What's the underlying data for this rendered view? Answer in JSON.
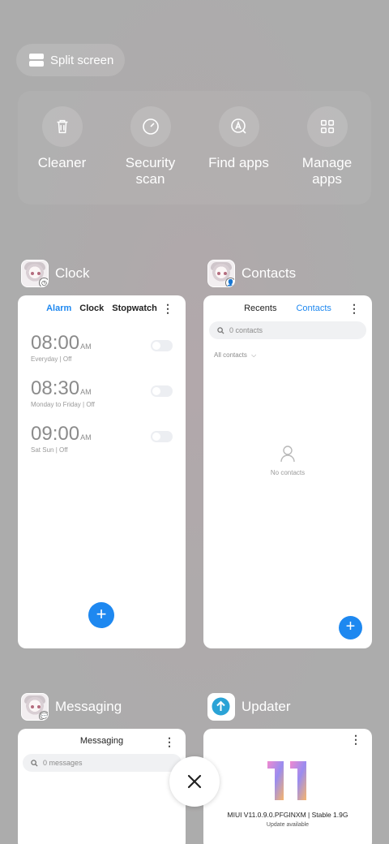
{
  "split_screen": {
    "label": "Split screen"
  },
  "tools": [
    {
      "label": "Cleaner",
      "icon": "trash-icon"
    },
    {
      "label": "Security scan",
      "icon": "speedometer-icon"
    },
    {
      "label": "Find apps",
      "icon": "app-search-icon"
    },
    {
      "label": "Manage apps",
      "icon": "grid-icon"
    }
  ],
  "apps": {
    "clock": {
      "name": "Clock",
      "tabs": [
        "Alarm",
        "Clock",
        "Stopwatch"
      ],
      "active_tab": "Alarm",
      "alarms": [
        {
          "time": "08:00",
          "ampm": "AM",
          "sub": "Everyday | Off"
        },
        {
          "time": "08:30",
          "ampm": "AM",
          "sub": "Monday to Friday | Off"
        },
        {
          "time": "09:00",
          "ampm": "AM",
          "sub": "Sat Sun | Off"
        }
      ],
      "fab": "+"
    },
    "contacts": {
      "name": "Contacts",
      "tabs": [
        "Recents",
        "Contacts"
      ],
      "active_tab": "Contacts",
      "search_placeholder": "0 contacts",
      "filter": "All contacts",
      "empty_text": "No contacts",
      "fab": "+"
    },
    "messaging": {
      "name": "Messaging",
      "title": "Messaging",
      "search_placeholder": "0 messages"
    },
    "updater": {
      "name": "Updater",
      "logo_text": "11",
      "version": "MIUI V11.0.9.0.PFGINXM | Stable 1.9G",
      "status": "Update available"
    }
  },
  "colors": {
    "accent": "#1e88f0",
    "card": "#ffffff",
    "background": "#acacac"
  }
}
